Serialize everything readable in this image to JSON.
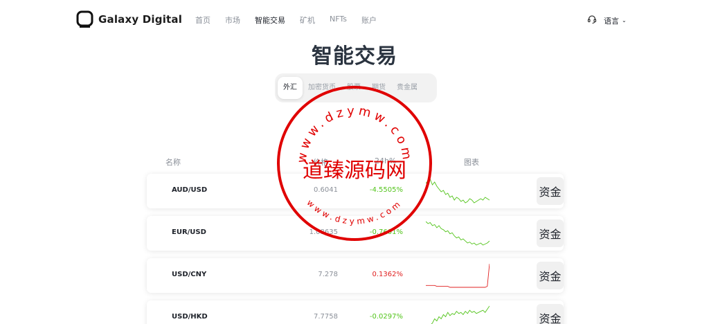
{
  "header": {
    "brand": "Galaxy Digital",
    "nav": [
      "首页",
      "市场",
      "智能交易",
      "矿机",
      "NFTs",
      "账户"
    ],
    "nav_active": 2,
    "language_label": "语言",
    "support_icon": "headset-icon",
    "language_icon": "chevron-down-icon"
  },
  "page": {
    "title": "智能交易"
  },
  "tabs": [
    "外汇",
    "加密货币",
    "股票",
    "期货",
    "贵金属"
  ],
  "tabs_active": 0,
  "table": {
    "headers": {
      "name": "名称",
      "price": "价格",
      "change": "24h%",
      "chart": "图表"
    },
    "rows": [
      {
        "pair": "AUD/USD",
        "price": "0.6041",
        "change": "-4.5505%",
        "direction": "up",
        "action": "资金",
        "spark": [
          12,
          10,
          9,
          13,
          11,
          14,
          16,
          18,
          17,
          20,
          19,
          22,
          21,
          24,
          22,
          23,
          25,
          24,
          26,
          25,
          23,
          24,
          26,
          25,
          24,
          23,
          24,
          22,
          23,
          24
        ]
      },
      {
        "pair": "EUR/USD",
        "price": "1.08635",
        "change": "-0.7601%",
        "direction": "up",
        "action": "资金",
        "spark": [
          6,
          8,
          7,
          10,
          9,
          12,
          10,
          13,
          14,
          16,
          15,
          18,
          17,
          20,
          22,
          21,
          24,
          23,
          25,
          27,
          26,
          28,
          27,
          29,
          28,
          27,
          29,
          28,
          27,
          25
        ]
      },
      {
        "pair": "USD/CNY",
        "price": "7.278",
        "change": "0.1362%",
        "direction": "down",
        "action": "资金",
        "spark": [
          26,
          26,
          26,
          26,
          26,
          27,
          27,
          27,
          27,
          27,
          27,
          28,
          28,
          28,
          28,
          28,
          28,
          28,
          28,
          28,
          28,
          28,
          28,
          28,
          28,
          28,
          28,
          28,
          27,
          3
        ]
      },
      {
        "pair": "USD/HKD",
        "price": "7.7758",
        "change": "-0.0297%",
        "direction": "up",
        "action": "资金",
        "spark": [
          30,
          28,
          26,
          24,
          20,
          22,
          18,
          20,
          16,
          18,
          14,
          17,
          15,
          16,
          13,
          15,
          14,
          16,
          13,
          15,
          12,
          14,
          13,
          15,
          14,
          13,
          12,
          14,
          11,
          8
        ]
      }
    ]
  },
  "colors": {
    "up": "#52c41a",
    "down": "#e02020",
    "title": "#2b3440",
    "seal": "#e00000"
  },
  "watermark": {
    "text": "道臻源码网",
    "arc_top": "www.dzymw.com",
    "arc_bottom": "www.dzymw.com"
  }
}
